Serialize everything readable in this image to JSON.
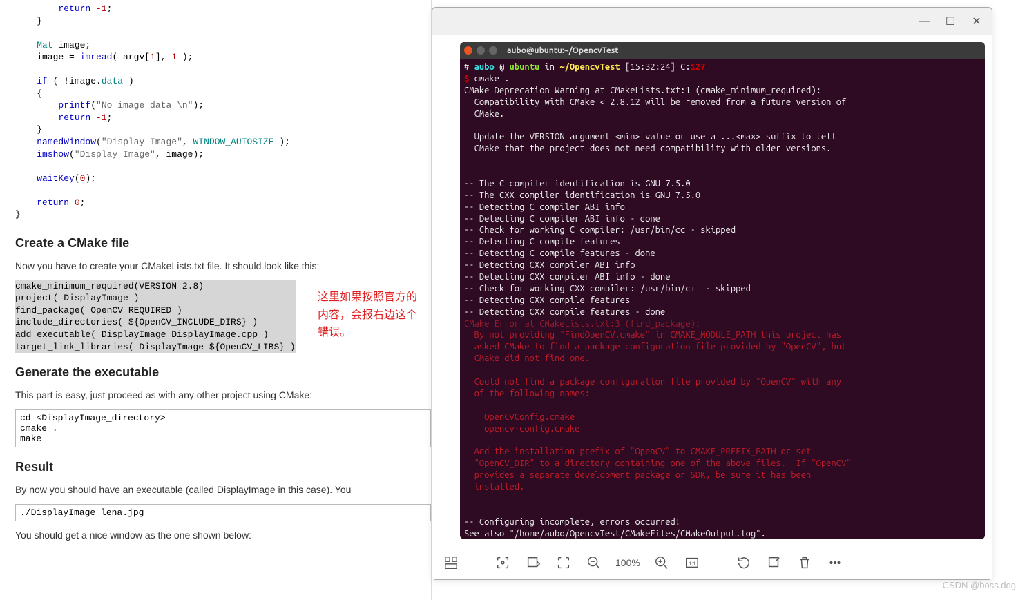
{
  "doc": {
    "code_top": "        return -1;\n    }\n\n    Mat image;\n    image = imread( argv[1], 1 );\n\n    if ( !image.data )\n    {\n        printf(\"No image data \\n\");\n        return -1;\n    }\n    namedWindow(\"Display Image\", WINDOW_AUTOSIZE );\n    imshow(\"Display Image\", image);\n\n    waitKey(0);\n\n    return 0;\n}",
    "h_cmake": "Create a CMake file",
    "p_cmake": "Now you have to create your CMakeLists.txt file. It should look like this:",
    "cmake_code": "cmake_minimum_required(VERSION 2.8)\nproject( DisplayImage )\nfind_package( OpenCV REQUIRED )\ninclude_directories( ${OpenCV_INCLUDE_DIRS} )\nadd_executable( DisplayImage DisplayImage.cpp )\ntarget_link_libraries( DisplayImage ${OpenCV_LIBS} )",
    "h_gen": "Generate the executable",
    "p_gen": "This part is easy, just proceed as with any other project using CMake:",
    "gen_code": "cd <DisplayImage_directory>\ncmake .\nmake",
    "h_result": "Result",
    "p_result1": "By now you should have an executable (called DisplayImage in this case). You",
    "run_code": "./DisplayImage lena.jpg",
    "p_result2": "You should get a nice window as the one shown below:"
  },
  "note": {
    "line1": "这里如果按照官方的",
    "line2": "内容，会报右边这个",
    "line3": "错误。"
  },
  "window": {
    "minimize": "—",
    "maximize": "☐",
    "close": "✕"
  },
  "terminal": {
    "title": "aubo@ubuntu:~/OpencvTest",
    "prompt_user": "aubo",
    "prompt_host": "ubuntu",
    "prompt_path": "~/OpencvTest",
    "prompt_time": "[15:32:24]",
    "prompt_c": "C:",
    "prompt_cval": "127",
    "cmd1": "cmake .",
    "depwarn1": "CMake Deprecation Warning at CMakeLists.txt:1 (cmake_minimum_required):",
    "depwarn2": "  Compatibility with CMake < 2.8.12 will be removed from a future version of",
    "depwarn3": "  CMake.",
    "depwarn4": "  Update the VERSION argument <min> value or use a ...<max> suffix to tell",
    "depwarn5": "  CMake that the project does not need compatibility with older versions.",
    "det01": "-- The C compiler identification is GNU 7.5.0",
    "det02": "-- The CXX compiler identification is GNU 7.5.0",
    "det03": "-- Detecting C compiler ABI info",
    "det04": "-- Detecting C compiler ABI info - done",
    "det05": "-- Check for working C compiler: /usr/bin/cc - skipped",
    "det06": "-- Detecting C compile features",
    "det07": "-- Detecting C compile features - done",
    "det08": "-- Detecting CXX compiler ABI info",
    "det09": "-- Detecting CXX compiler ABI info - done",
    "det10": "-- Check for working CXX compiler: /usr/bin/c++ - skipped",
    "det11": "-- Detecting CXX compile features",
    "det12": "-- Detecting CXX compile features - done",
    "err_head": "CMake Error at CMakeLists.txt:3 (find_package):",
    "err1": "  By not providing \"FindOpenCV.cmake\" in CMAKE_MODULE_PATH this project has",
    "err2": "  asked CMake to find a package configuration file provided by \"OpenCV\", but",
    "err3": "  CMake did not find one.",
    "err4": "  Could not find a package configuration file provided by \"OpenCV\" with any",
    "err5": "  of the following names:",
    "err6": "    OpenCVConfig.cmake",
    "err7": "    opencv-config.cmake",
    "err8": "  Add the installation prefix of \"OpenCV\" to CMAKE_PREFIX_PATH or set",
    "err9": "  \"OpenCV_DIR\" to a directory containing one of the above files.  If \"OpenCV\"",
    "err10": "  provides a separate development package or SDK, be sure it has been",
    "err11": "  installed.",
    "conf1": "-- Configuring incomplete, errors occurred!",
    "conf2": "See also \"/home/aubo/OpencvTest/CMakeFiles/CMakeOutput.log\"."
  },
  "toolbar": {
    "zoom_text": "100%"
  },
  "watermark": "CSDN @boss.dog"
}
